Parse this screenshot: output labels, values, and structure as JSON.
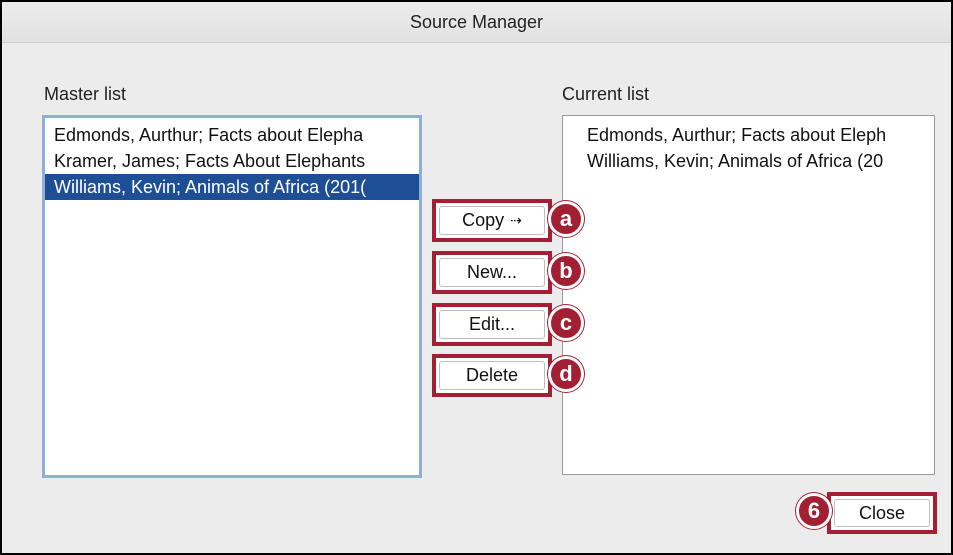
{
  "window": {
    "title": "Source Manager"
  },
  "master_list": {
    "label": "Master list",
    "items": [
      "Edmonds, Aurthur; Facts about Elepha",
      "Kramer, James; Facts About Elephants",
      "Williams, Kevin; Animals of Africa (201("
    ],
    "selected_index": 2
  },
  "current_list": {
    "label": "Current list",
    "items": [
      "Edmonds, Aurthur; Facts about Eleph",
      "Williams, Kevin; Animals of Africa (20"
    ]
  },
  "buttons": {
    "copy": "Copy",
    "copy_arrow": "⇢",
    "new": "New...",
    "edit": "Edit...",
    "delete": "Delete",
    "close": "Close"
  },
  "callouts": {
    "a": "a",
    "b": "b",
    "c": "c",
    "d": "d",
    "close": "6"
  },
  "colors": {
    "highlight": "#a31f34",
    "selection": "#1e4f96"
  }
}
